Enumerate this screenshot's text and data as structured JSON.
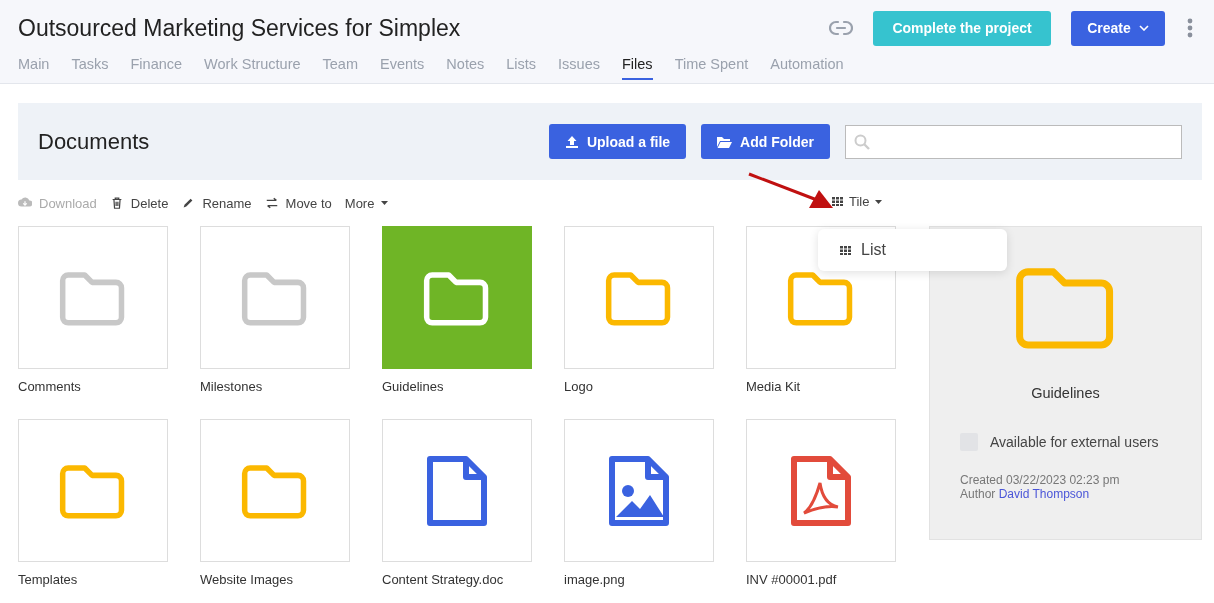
{
  "header": {
    "title": "Outsourced Marketing Services for Simplex",
    "complete_button": "Complete the project",
    "create_button": "Create"
  },
  "tabs": [
    {
      "label": "Main",
      "selected": false
    },
    {
      "label": "Tasks",
      "selected": false
    },
    {
      "label": "Finance",
      "selected": false
    },
    {
      "label": "Work Structure",
      "selected": false
    },
    {
      "label": "Team",
      "selected": false
    },
    {
      "label": "Events",
      "selected": false
    },
    {
      "label": "Notes",
      "selected": false
    },
    {
      "label": "Lists",
      "selected": false
    },
    {
      "label": "Issues",
      "selected": false
    },
    {
      "label": "Files",
      "selected": true
    },
    {
      "label": "Time Spent",
      "selected": false
    },
    {
      "label": "Automation",
      "selected": false
    }
  ],
  "documents": {
    "title": "Documents",
    "upload_button": "Upload a file",
    "add_folder_button": "Add Folder"
  },
  "toolbar": [
    {
      "label": "Download",
      "disabled": true
    },
    {
      "label": "Delete",
      "disabled": false
    },
    {
      "label": "Rename",
      "disabled": false
    },
    {
      "label": "Move to",
      "disabled": false
    },
    {
      "label": "More",
      "disabled": false
    }
  ],
  "view_menu": {
    "current": "Tile",
    "options": [
      "List"
    ]
  },
  "files": [
    {
      "name": "Comments",
      "kind": "folder",
      "selected": false,
      "color": "#c8c8c8"
    },
    {
      "name": "Milestones",
      "kind": "folder",
      "selected": false,
      "color": "#c8c8c8"
    },
    {
      "name": "Guidelines",
      "kind": "folder",
      "selected": true,
      "color": "#ffffff"
    },
    {
      "name": "Logo",
      "kind": "folder",
      "selected": false,
      "color": "#fbb800"
    },
    {
      "name": "Media Kit",
      "kind": "folder",
      "selected": false,
      "color": "#fbb800"
    },
    {
      "name": "Templates",
      "kind": "folder",
      "selected": false,
      "color": "#fbb800"
    },
    {
      "name": "Website Images",
      "kind": "folder",
      "selected": false,
      "color": "#fbb800"
    },
    {
      "name": "Content Strategy.doc",
      "kind": "document",
      "selected": false,
      "color": "#3a62e0"
    },
    {
      "name": "image.png",
      "kind": "image",
      "selected": false,
      "color": "#3a62e0"
    },
    {
      "name": "INV #00001.pdf",
      "kind": "pdf",
      "selected": false,
      "color": "#e24b3b"
    }
  ],
  "details": {
    "name": "Guidelines",
    "external_label": "Available for external users",
    "external_checked": false,
    "created": "Created 03/22/2023 02:23 pm",
    "author_label": "Author",
    "author": "David Thompson"
  }
}
